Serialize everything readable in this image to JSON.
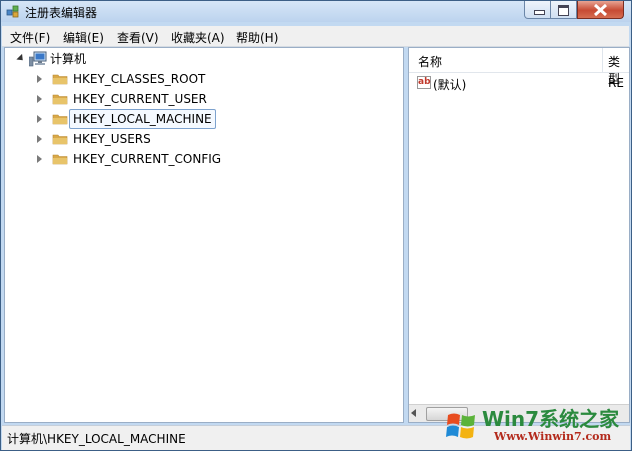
{
  "window": {
    "title": "注册表编辑器"
  },
  "menu": {
    "items": [
      "文件(F)",
      "编辑(E)",
      "查看(V)",
      "收藏夹(A)",
      "帮助(H)"
    ]
  },
  "tree": {
    "root_label": "计算机",
    "items": [
      {
        "label": "HKEY_CLASSES_ROOT",
        "selected": false
      },
      {
        "label": "HKEY_CURRENT_USER",
        "selected": false
      },
      {
        "label": "HKEY_LOCAL_MACHINE",
        "selected": true
      },
      {
        "label": "HKEY_USERS",
        "selected": false
      },
      {
        "label": "HKEY_CURRENT_CONFIG",
        "selected": false
      }
    ]
  },
  "values": {
    "headers": [
      "名称",
      "类型"
    ],
    "rows": [
      {
        "name": "(默认)",
        "type": "RE"
      }
    ]
  },
  "status": {
    "path": "计算机\\HKEY_LOCAL_MACHINE"
  },
  "watermark": {
    "main": "Win7系统之家",
    "sub": "Www.Winwin7.com"
  },
  "colors": {
    "selection_border": "#7da2ce",
    "folder": "#e8c46a",
    "watermark_green": "#2b8a3e",
    "watermark_red": "#b32a1c"
  }
}
